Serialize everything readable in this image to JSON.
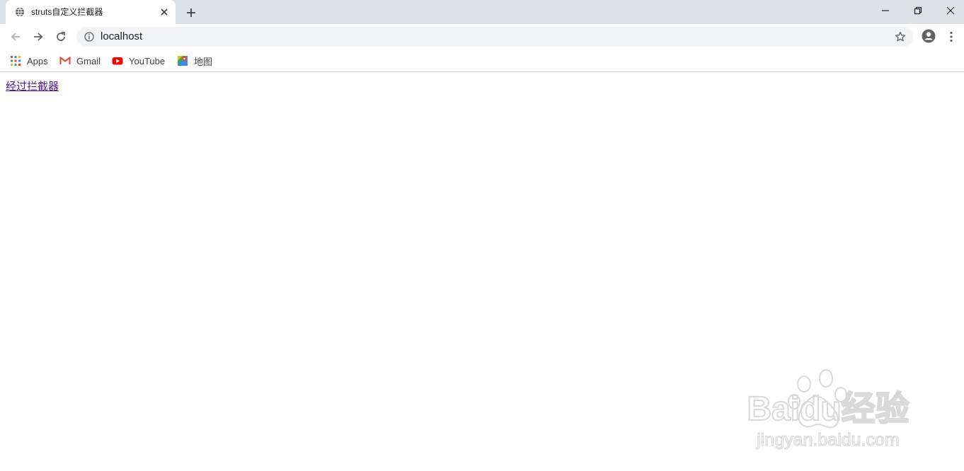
{
  "tab": {
    "title": "struts自定义拦截器",
    "favicon": "globe-icon"
  },
  "toolbar": {
    "address": "localhost"
  },
  "bookmarks": [
    {
      "label": "Apps",
      "icon": "apps-grid-icon"
    },
    {
      "label": "Gmail",
      "icon": "gmail-icon"
    },
    {
      "label": "YouTube",
      "icon": "youtube-icon"
    },
    {
      "label": "地图",
      "icon": "maps-icon"
    }
  ],
  "content": {
    "link_text": "经过拦截器"
  },
  "watermark": {
    "brand_text": "Baidu经验",
    "url_text": "jingyan.baidu.com"
  },
  "colors": {
    "tabstrip_bg": "#dee1e6",
    "omnibox_bg": "#f1f3f4",
    "visited_link": "#551a8b",
    "icon_gray": "#5f6368",
    "youtube_red": "#ff0000",
    "gmail_red": "#ea4335"
  }
}
